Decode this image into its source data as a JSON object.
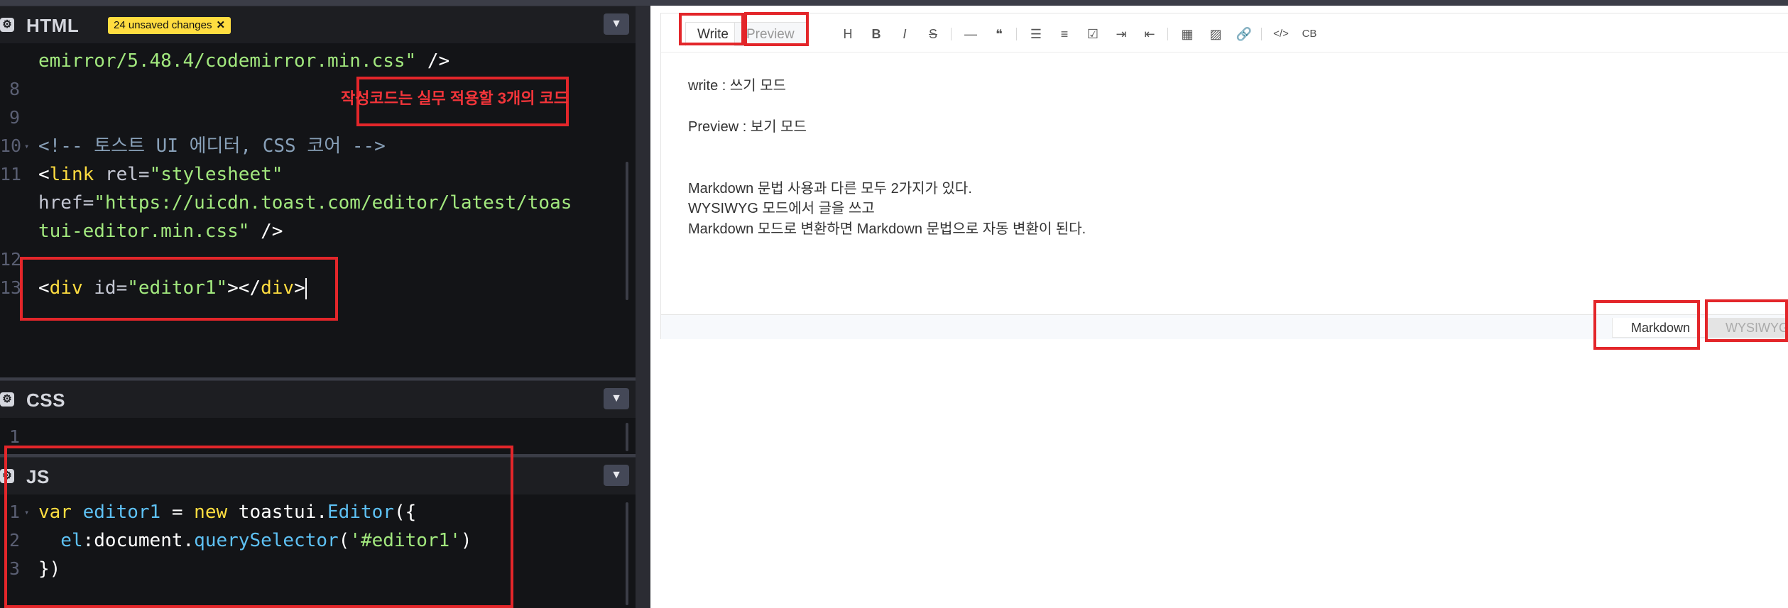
{
  "html_panel": {
    "title": "HTML",
    "unsaved_badge": "24 unsaved changes",
    "lines": [
      {
        "num": "",
        "tokens": [
          {
            "c": "c-str",
            "t": "emirror/5.48.4/codemirror.min.css\""
          },
          {
            "c": "c-plain",
            "t": " />"
          }
        ]
      },
      {
        "num": "8",
        "tokens": []
      },
      {
        "num": "9",
        "tokens": []
      },
      {
        "num": "10",
        "fold": true,
        "tokens": [
          {
            "c": "c-com",
            "t": "<!-- 토스트 UI 에디터, CSS 코어 -->"
          }
        ]
      },
      {
        "num": "11",
        "tokens": [
          {
            "c": "c-plain",
            "t": "<"
          },
          {
            "c": "c-tag",
            "t": "link"
          },
          {
            "c": "c-attr",
            "t": " rel="
          },
          {
            "c": "c-str",
            "t": "\"stylesheet\""
          }
        ]
      },
      {
        "num": "",
        "tokens": [
          {
            "c": "c-attr",
            "t": "href="
          },
          {
            "c": "c-str",
            "t": "\"https://uicdn.toast.com/editor/latest/toas"
          }
        ]
      },
      {
        "num": "",
        "tokens": [
          {
            "c": "c-str",
            "t": "tui-editor.min.css\""
          },
          {
            "c": "c-plain",
            "t": " />"
          }
        ]
      },
      {
        "num": "12",
        "tokens": []
      },
      {
        "num": "13",
        "cursor": true,
        "tokens": [
          {
            "c": "c-plain",
            "t": "<"
          },
          {
            "c": "c-tag",
            "t": "div"
          },
          {
            "c": "c-attr",
            "t": " id="
          },
          {
            "c": "c-str",
            "t": "\"editor1\""
          },
          {
            "c": "c-plain",
            "t": "></"
          },
          {
            "c": "c-tag",
            "t": "div"
          },
          {
            "c": "c-plain",
            "t": ">"
          }
        ]
      }
    ]
  },
  "annotation_note": "작성코드는 실무 적용할 3개의 코드",
  "css_panel": {
    "title": "CSS",
    "lines": [
      {
        "num": "1",
        "tokens": []
      }
    ]
  },
  "js_panel": {
    "title": "JS",
    "lines": [
      {
        "num": "1",
        "fold": true,
        "tokens": [
          {
            "c": "c-kw",
            "t": "var"
          },
          {
            "c": "c-var",
            "t": " editor1"
          },
          {
            "c": "c-plain",
            "t": " = "
          },
          {
            "c": "c-kw",
            "t": "new"
          },
          {
            "c": "c-plain",
            "t": " toastui."
          },
          {
            "c": "c-fn",
            "t": "Editor"
          },
          {
            "c": "c-plain",
            "t": "({"
          }
        ]
      },
      {
        "num": "2",
        "tokens": [
          {
            "c": "c-var",
            "t": "  el"
          },
          {
            "c": "c-plain",
            "t": ":document."
          },
          {
            "c": "c-fn",
            "t": "querySelector"
          },
          {
            "c": "c-plain",
            "t": "("
          },
          {
            "c": "c-str",
            "t": "'#editor1'"
          },
          {
            "c": "c-plain",
            "t": ")"
          }
        ]
      },
      {
        "num": "3",
        "tokens": [
          {
            "c": "c-plain",
            "t": "})"
          }
        ]
      }
    ]
  },
  "editor": {
    "tabs": {
      "write": "Write",
      "preview": "Preview"
    },
    "toolbar": [
      "H",
      "B",
      "I",
      "S",
      "—",
      "❝",
      "☰",
      "≡",
      "☑",
      "⇥",
      "⇤",
      "▦",
      "▨",
      "🔗",
      "</>",
      "CB"
    ],
    "content": [
      "write : 쓰기 모드",
      "Preview : 보기 모드",
      "Markdown 문법 사용과 다른 모두 2가지가 있다.",
      "WYSIWYG 모드에서 글을 쓰고",
      "Markdown 모드로 변환하면 Markdown 문법으로 자동 변환이 된다."
    ],
    "modes": {
      "markdown": "Markdown",
      "wysiwyg": "WYSIWYG"
    }
  }
}
